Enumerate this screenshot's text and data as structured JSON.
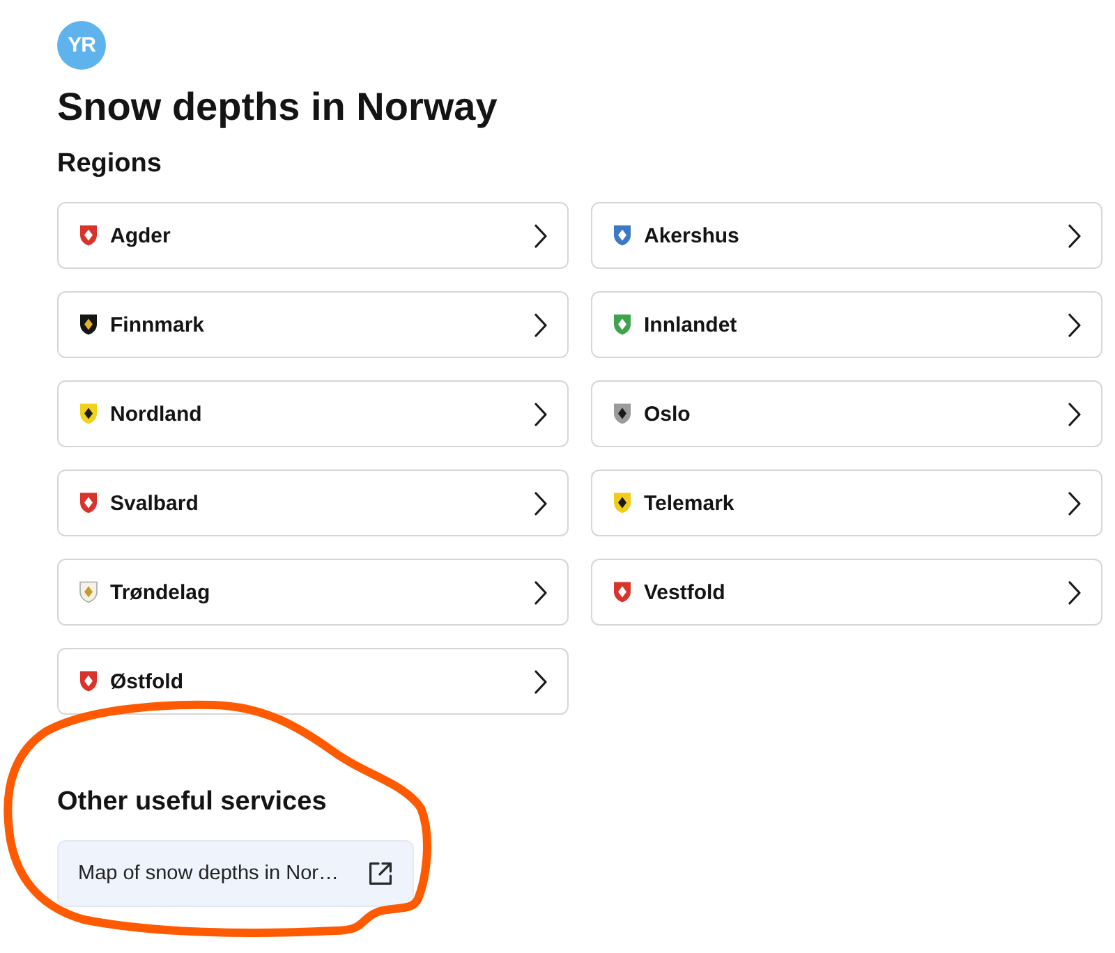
{
  "logo": {
    "text": "YR"
  },
  "title": "Snow depths in Norway",
  "regions": {
    "heading": "Regions",
    "items": [
      {
        "name": "Agder",
        "color": "#d8342c"
      },
      {
        "name": "Akershus",
        "color": "#3d78c4"
      },
      {
        "name": "Finnmark",
        "color": "#151515"
      },
      {
        "name": "Innlandet",
        "color": "#3fa34d"
      },
      {
        "name": "Nordland",
        "color": "#f2d21b"
      },
      {
        "name": "Oslo",
        "color": "#9b9b9b"
      },
      {
        "name": "Svalbard",
        "color": "#d8342c"
      },
      {
        "name": "Telemark",
        "color": "#f2cc1b"
      },
      {
        "name": "Trøndelag",
        "color": "#f4f1e6"
      },
      {
        "name": "Vestfold",
        "color": "#d8342c"
      },
      {
        "name": "Østfold",
        "color": "#d8342c"
      }
    ]
  },
  "other_services": {
    "heading": "Other useful services",
    "highlighted": true,
    "links": [
      {
        "label": "Map of snow depths in Nor…",
        "external": true
      }
    ]
  }
}
